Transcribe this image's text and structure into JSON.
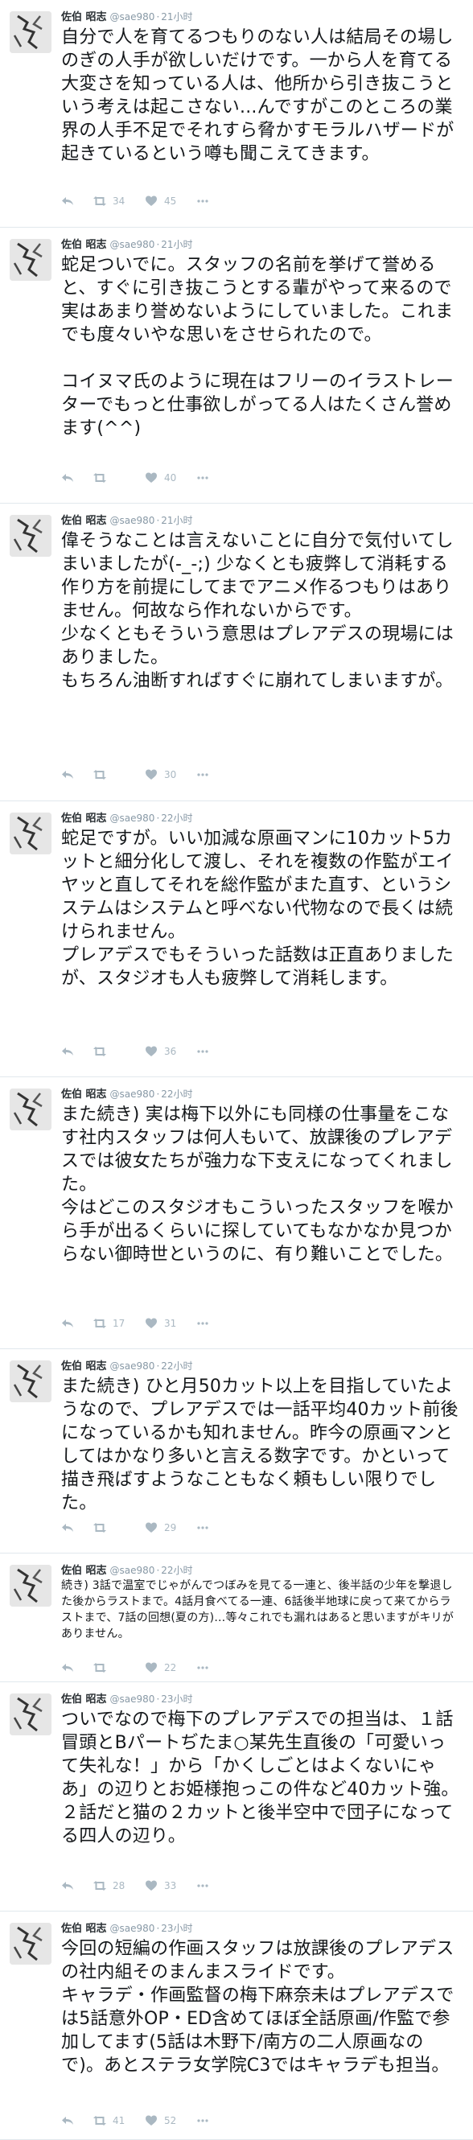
{
  "author": {
    "name": "佐伯 昭志",
    "handle": "@sae980",
    "dot": "·"
  },
  "tweets": [
    {
      "time": "21小时",
      "text": "自分で人を育てるつもりのない人は結局その場しのぎの人手が欲しいだけです。一から人を育てる大変さを知っている人は、他所から引き抜こうという考えは起こさない...んですがこのところの業界の人手不足でそれすら脅かすモラルハザードが起きているという噂も聞こえてきます。",
      "retweets": "34",
      "likes": "45"
    },
    {
      "time": "21小时",
      "text": "蛇足ついでに。スタッフの名前を挙げて誉めると、すぐに引き抜こうとする輩がやって来るので実はあまり誉めないようにしていました。これまでも度々いやな思いをさせられたので。\n\nコイヌマ氏のように現在はフリーのイラストレーターでもっと仕事欲しがってる人はたくさん誉めます(^^)",
      "retweets": "",
      "likes": "40"
    },
    {
      "time": "21小时",
      "text": "偉そうなことは言えないことに自分で気付いてしまいましたが(-_-;) 少なくとも疲弊して消耗する作り方を前提にしてまでアニメ作るつもりはありません。何故なら作れないからです。\n少なくともそういう意思はプレアデスの現場にはありました。\nもちろん油断すればすぐに崩れてしまいますが。",
      "retweets": "",
      "likes": "30"
    },
    {
      "time": "22小时",
      "text": "蛇足ですが。いい加減な原画マンに10カット5カットと細分化して渡し、それを複数の作監がエイヤッと直してそれを総作監がまた直す、というシステムはシステムと呼べない代物なので長くは続けられません。\nプレアデスでもそういった話数は正直ありましたが、スタジオも人も疲弊して消耗します。",
      "retweets": "",
      "likes": "36"
    },
    {
      "time": "22小时",
      "text": "また続き) 実は梅下以外にも同様の仕事量をこなす社内スタッフは何人もいて、放課後のプレアデスでは彼女たちが強力な下支えになってくれました。\n今はどこのスタジオもこういったスタッフを喉から手が出るくらいに探していてもなかなか見つからない御時世というのに、有り難いことでした。",
      "retweets": "17",
      "likes": "31"
    },
    {
      "time": "22小时",
      "text": "また続き) ひと月50カット以上を目指していたようなので、プレアデスでは一話平均40カット前後になっているかも知れません。昨今の原画マンとしてはかなり多いと言える数字です。かといって描き飛ばすようなこともなく頼もしい限りでした。",
      "retweets": "",
      "likes": "29"
    },
    {
      "time": "22小时",
      "text": "続き) 3話で温室でじゃがんでつぼみを見てる一連と、後半話の少年を撃退した後からラストまで。4話月食べてる一連、6話後半地球に戻って来てからラストまで、7話の回想(夏の方)…等々これでも漏れはあると思いますがキリがありません。",
      "retweets": "",
      "likes": "22"
    },
    {
      "time": "23小时",
      "text": "ついでなので梅下のプレアデスでの担当は、１話冒頭とBパートぢたま○某先生直後の「可愛いって失礼な！」から「かくしごとはよくないにゃあ」の辺りとお姫様抱っこの件など40カット強。２話だと猫の２カットと後半空中で団子になってる四人の辺り。",
      "retweets": "28",
      "likes": "33"
    },
    {
      "time": "23小时",
      "text": "今回の短編の作画スタッフは放課後のプレアデスの社内組そのまんまスライドです。\nキャラデ・作画監督の梅下麻奈未はプレアデスでは5話意外OP・ED含めてほぼ全話原画/作監で参加してます(5話は木野下/南方の二人原画なので)。あとステラ女学院C3ではキャラデも担当。",
      "retweets": "41",
      "likes": "52"
    }
  ],
  "icons": [
    "reply-icon",
    "retweet-icon",
    "like-icon",
    "more-icon"
  ],
  "colors": {
    "divider": "#e1e8ed",
    "muted": "#aab8c2",
    "meta": "#8899a6"
  }
}
